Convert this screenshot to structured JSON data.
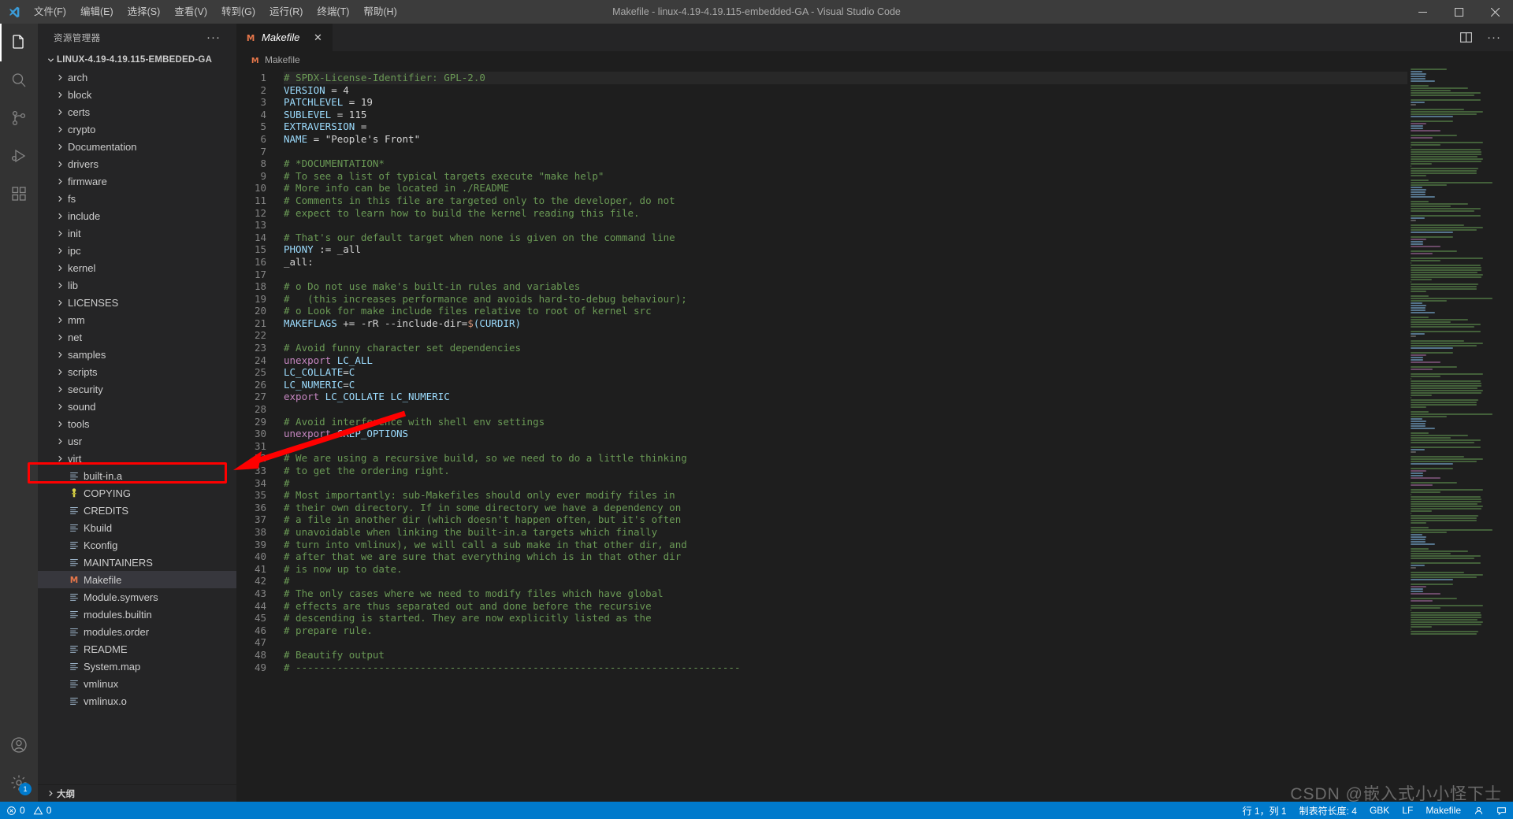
{
  "window": {
    "title": "Makefile - linux-4.19-4.19.115-embedded-GA - Visual Studio Code",
    "minimize_label": "minimize-icon",
    "maximize_label": "maximize-icon",
    "close_label": "close-icon"
  },
  "menu": {
    "items": [
      {
        "label": "文件(F)"
      },
      {
        "label": "编辑(E)"
      },
      {
        "label": "选择(S)"
      },
      {
        "label": "查看(V)"
      },
      {
        "label": "转到(G)"
      },
      {
        "label": "运行(R)"
      },
      {
        "label": "终端(T)"
      },
      {
        "label": "帮助(H)"
      }
    ]
  },
  "activitybar": {
    "items": [
      {
        "name": "explorer-icon",
        "active": true
      },
      {
        "name": "search-icon",
        "active": false
      },
      {
        "name": "source-control-icon",
        "active": false
      },
      {
        "name": "run-and-debug-icon",
        "active": false
      },
      {
        "name": "extensions-icon",
        "active": false
      }
    ],
    "bottom": [
      {
        "name": "account-icon",
        "badge": ""
      },
      {
        "name": "manage-gear-icon",
        "badge": "1"
      }
    ]
  },
  "sidebar": {
    "title": "资源管理器",
    "more_label": "···",
    "root": "LINUX-4.19-4.19.115-EMBEDED-GA",
    "outline": "大纲",
    "tree": [
      {
        "label": "arch",
        "type": "folder"
      },
      {
        "label": "block",
        "type": "folder"
      },
      {
        "label": "certs",
        "type": "folder"
      },
      {
        "label": "crypto",
        "type": "folder"
      },
      {
        "label": "Documentation",
        "type": "folder"
      },
      {
        "label": "drivers",
        "type": "folder"
      },
      {
        "label": "firmware",
        "type": "folder"
      },
      {
        "label": "fs",
        "type": "folder"
      },
      {
        "label": "include",
        "type": "folder"
      },
      {
        "label": "init",
        "type": "folder"
      },
      {
        "label": "ipc",
        "type": "folder"
      },
      {
        "label": "kernel",
        "type": "folder"
      },
      {
        "label": "lib",
        "type": "folder"
      },
      {
        "label": "LICENSES",
        "type": "folder"
      },
      {
        "label": "mm",
        "type": "folder"
      },
      {
        "label": "net",
        "type": "folder"
      },
      {
        "label": "samples",
        "type": "folder"
      },
      {
        "label": "scripts",
        "type": "folder"
      },
      {
        "label": "security",
        "type": "folder"
      },
      {
        "label": "sound",
        "type": "folder"
      },
      {
        "label": "tools",
        "type": "folder"
      },
      {
        "label": "usr",
        "type": "folder"
      },
      {
        "label": "virt",
        "type": "folder"
      },
      {
        "label": "built-in.a",
        "type": "file"
      },
      {
        "label": "COPYING",
        "type": "license"
      },
      {
        "label": "CREDITS",
        "type": "file"
      },
      {
        "label": "Kbuild",
        "type": "file"
      },
      {
        "label": "Kconfig",
        "type": "file"
      },
      {
        "label": "MAINTAINERS",
        "type": "file"
      },
      {
        "label": "Makefile",
        "type": "makefile",
        "selected": true
      },
      {
        "label": "Module.symvers",
        "type": "file"
      },
      {
        "label": "modules.builtin",
        "type": "file"
      },
      {
        "label": "modules.order",
        "type": "file"
      },
      {
        "label": "README",
        "type": "file"
      },
      {
        "label": "System.map",
        "type": "file"
      },
      {
        "label": "vmlinux",
        "type": "file"
      },
      {
        "label": "vmlinux.o",
        "type": "file"
      }
    ]
  },
  "editor": {
    "tab": {
      "label": "Makefile",
      "icon": "makefile-icon",
      "close": "✕"
    },
    "actions": [
      {
        "name": "split-editor-icon"
      },
      {
        "name": "more-actions-icon",
        "label": "···"
      }
    ],
    "breadcrumb": "Makefile",
    "first_line": 1,
    "lines": [
      {
        "n": 1,
        "tokens": [
          {
            "t": "# SPDX-License-Identifier: GPL-2.0",
            "c": "cm"
          }
        ],
        "current": true
      },
      {
        "n": 2,
        "tokens": [
          {
            "t": "VERSION",
            "c": "id"
          },
          {
            "t": " = ",
            "c": "op"
          },
          {
            "t": "4",
            "c": "op"
          }
        ]
      },
      {
        "n": 3,
        "tokens": [
          {
            "t": "PATCHLEVEL",
            "c": "id"
          },
          {
            "t": " = ",
            "c": "op"
          },
          {
            "t": "19",
            "c": "op"
          }
        ]
      },
      {
        "n": 4,
        "tokens": [
          {
            "t": "SUBLEVEL",
            "c": "id"
          },
          {
            "t": " = ",
            "c": "op"
          },
          {
            "t": "115",
            "c": "op"
          }
        ]
      },
      {
        "n": 5,
        "tokens": [
          {
            "t": "EXTRAVERSION",
            "c": "id"
          },
          {
            "t": " =",
            "c": "op"
          }
        ]
      },
      {
        "n": 6,
        "tokens": [
          {
            "t": "NAME",
            "c": "id"
          },
          {
            "t": " = ",
            "c": "op"
          },
          {
            "t": "\"People's Front\"",
            "c": "op"
          }
        ]
      },
      {
        "n": 7,
        "tokens": []
      },
      {
        "n": 8,
        "tokens": [
          {
            "t": "# *DOCUMENTATION*",
            "c": "cm"
          }
        ]
      },
      {
        "n": 9,
        "tokens": [
          {
            "t": "# To see a list of typical targets execute \"make help\"",
            "c": "cm"
          }
        ]
      },
      {
        "n": 10,
        "tokens": [
          {
            "t": "# More info can be located in ./README",
            "c": "cm"
          }
        ]
      },
      {
        "n": 11,
        "tokens": [
          {
            "t": "# Comments in this file are targeted only to the developer, do not",
            "c": "cm"
          }
        ]
      },
      {
        "n": 12,
        "tokens": [
          {
            "t": "# expect to learn how to build the kernel reading this file.",
            "c": "cm"
          }
        ]
      },
      {
        "n": 13,
        "tokens": []
      },
      {
        "n": 14,
        "tokens": [
          {
            "t": "# That's our default target when none is given on the command line",
            "c": "cm"
          }
        ]
      },
      {
        "n": 15,
        "tokens": [
          {
            "t": "PHONY",
            "c": "id"
          },
          {
            "t": " := ",
            "c": "op"
          },
          {
            "t": "_all",
            "c": "op"
          }
        ]
      },
      {
        "n": 16,
        "tokens": [
          {
            "t": "_all:",
            "c": "op"
          }
        ]
      },
      {
        "n": 17,
        "tokens": []
      },
      {
        "n": 18,
        "tokens": [
          {
            "t": "# o Do not use make's built-in rules and variables",
            "c": "cm"
          }
        ]
      },
      {
        "n": 19,
        "tokens": [
          {
            "t": "#   (this increases performance and avoids hard-to-debug behaviour);",
            "c": "cm"
          }
        ]
      },
      {
        "n": 20,
        "tokens": [
          {
            "t": "# o Look for make include files relative to root of kernel src",
            "c": "cm"
          }
        ]
      },
      {
        "n": 21,
        "tokens": [
          {
            "t": "MAKEFLAGS",
            "c": "id"
          },
          {
            "t": " += -rR --include-dir=",
            "c": "op"
          },
          {
            "t": "$",
            "c": "var"
          },
          {
            "t": "(CURDIR)",
            "c": "id"
          }
        ]
      },
      {
        "n": 22,
        "tokens": []
      },
      {
        "n": 23,
        "tokens": [
          {
            "t": "# Avoid funny character set dependencies",
            "c": "cm"
          }
        ]
      },
      {
        "n": 24,
        "tokens": [
          {
            "t": "unexport",
            "c": "fn"
          },
          {
            "t": " LC_ALL",
            "c": "id"
          }
        ]
      },
      {
        "n": 25,
        "tokens": [
          {
            "t": "LC_COLLATE",
            "c": "id"
          },
          {
            "t": "=",
            "c": "op"
          },
          {
            "t": "C",
            "c": "id"
          }
        ]
      },
      {
        "n": 26,
        "tokens": [
          {
            "t": "LC_NUMERIC",
            "c": "id"
          },
          {
            "t": "=",
            "c": "op"
          },
          {
            "t": "C",
            "c": "id"
          }
        ]
      },
      {
        "n": 27,
        "tokens": [
          {
            "t": "export",
            "c": "fn"
          },
          {
            "t": " LC_COLLATE LC_NUMERIC",
            "c": "id"
          }
        ]
      },
      {
        "n": 28,
        "tokens": []
      },
      {
        "n": 29,
        "tokens": [
          {
            "t": "# Avoid interference with shell env settings",
            "c": "cm"
          }
        ]
      },
      {
        "n": 30,
        "tokens": [
          {
            "t": "unexport",
            "c": "fn"
          },
          {
            "t": " GREP_OPTIONS",
            "c": "id"
          }
        ]
      },
      {
        "n": 31,
        "tokens": []
      },
      {
        "n": 32,
        "tokens": [
          {
            "t": "# We are using a recursive build, so we need to do a little thinking",
            "c": "cm"
          }
        ]
      },
      {
        "n": 33,
        "tokens": [
          {
            "t": "# to get the ordering right.",
            "c": "cm"
          }
        ]
      },
      {
        "n": 34,
        "tokens": [
          {
            "t": "#",
            "c": "cm"
          }
        ]
      },
      {
        "n": 35,
        "tokens": [
          {
            "t": "# Most importantly: sub-Makefiles should only ever modify files in",
            "c": "cm"
          }
        ]
      },
      {
        "n": 36,
        "tokens": [
          {
            "t": "# their own directory. If in some directory we have a dependency on",
            "c": "cm"
          }
        ]
      },
      {
        "n": 37,
        "tokens": [
          {
            "t": "# a file in another dir (which doesn't happen often, but it's often",
            "c": "cm"
          }
        ]
      },
      {
        "n": 38,
        "tokens": [
          {
            "t": "# unavoidable when linking the built-in.a targets which finally",
            "c": "cm"
          }
        ]
      },
      {
        "n": 39,
        "tokens": [
          {
            "t": "# turn into vmlinux), we will call a sub make in that other dir, and",
            "c": "cm"
          }
        ]
      },
      {
        "n": 40,
        "tokens": [
          {
            "t": "# after that we are sure that everything which is in that other dir",
            "c": "cm"
          }
        ]
      },
      {
        "n": 41,
        "tokens": [
          {
            "t": "# is now up to date.",
            "c": "cm"
          }
        ]
      },
      {
        "n": 42,
        "tokens": [
          {
            "t": "#",
            "c": "cm"
          }
        ]
      },
      {
        "n": 43,
        "tokens": [
          {
            "t": "# The only cases where we need to modify files which have global",
            "c": "cm"
          }
        ]
      },
      {
        "n": 44,
        "tokens": [
          {
            "t": "# effects are thus separated out and done before the recursive",
            "c": "cm"
          }
        ]
      },
      {
        "n": 45,
        "tokens": [
          {
            "t": "# descending is started. They are now explicitly listed as the",
            "c": "cm"
          }
        ]
      },
      {
        "n": 46,
        "tokens": [
          {
            "t": "# prepare rule.",
            "c": "cm"
          }
        ]
      },
      {
        "n": 47,
        "tokens": []
      },
      {
        "n": 48,
        "tokens": [
          {
            "t": "# Beautify output",
            "c": "cm"
          }
        ]
      },
      {
        "n": 49,
        "tokens": [
          {
            "t": "# ---------------------------------------------------------------------------",
            "c": "cm"
          }
        ]
      }
    ]
  },
  "statusbar": {
    "left": [
      {
        "name": "remote-problems",
        "icon": "error-icon",
        "label": "0"
      },
      {
        "name": "warnings",
        "icon": "warning-icon",
        "label": "0"
      }
    ],
    "right": [
      {
        "name": "cursor-position",
        "label": "行 1，列 1"
      },
      {
        "name": "indentation",
        "label": "制表符长度: 4"
      },
      {
        "name": "encoding",
        "label": "GBK"
      },
      {
        "name": "eol",
        "label": "LF"
      },
      {
        "name": "language-mode",
        "label": "Makefile"
      },
      {
        "name": "live-share",
        "label": ""
      },
      {
        "name": "feedback",
        "label": ""
      }
    ]
  },
  "annotations": {
    "watermark": "CSDN @嵌入式小小怪下士",
    "highlight_box": {
      "name": "makefile-highlight-box",
      "color": "#ff0000"
    },
    "arrow": {
      "name": "pointer-arrow",
      "color": "#ff0000"
    }
  },
  "colors": {
    "accent": "#007acc",
    "annotation": "#ff0000",
    "titlebar": "#3c3c3c",
    "sidebar": "#252526",
    "editor": "#1e1e1e",
    "activitybar": "#333333",
    "selected_row": "#37373d"
  }
}
